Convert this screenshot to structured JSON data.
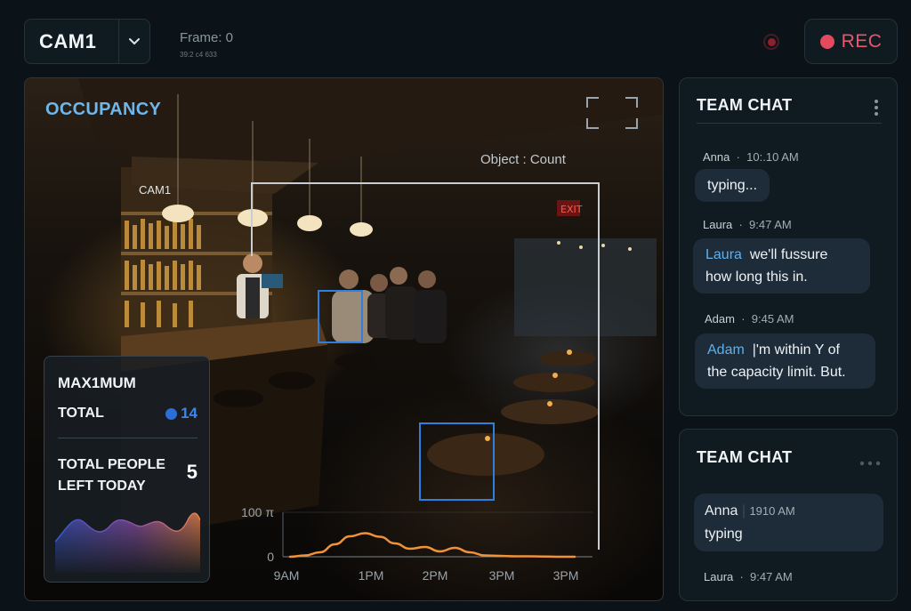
{
  "camera": {
    "selected": "CAM1",
    "frame": "Frame: 0",
    "frame_sub": "39:2 c4 633"
  },
  "record": {
    "label": "REC",
    "color": "#e6586a"
  },
  "feed": {
    "title": "OCCUPANCY",
    "cam_tag": "CAM1",
    "object_count_label": "Object : Count",
    "detection_color": "#2f7fe0"
  },
  "stats": {
    "max_label": "MAX1MUM",
    "total_label": "TOTAL",
    "total_value": "14",
    "left_label": "TOTAL PEOPLE LEFT TODAY",
    "left_value": "5"
  },
  "chart_data": {
    "type": "line",
    "x_ticks": [
      "9AM",
      "1PM",
      "2PM",
      "3PM",
      "3PM"
    ],
    "y_ticks": [
      "100 π",
      "0"
    ],
    "ylim": [
      0,
      100
    ],
    "series": [
      {
        "values": [
          0,
          3,
          10,
          28,
          46,
          53,
          45,
          30,
          18,
          22,
          12,
          20,
          10,
          3,
          2,
          1,
          1,
          0.5,
          0,
          0
        ]
      }
    ],
    "line_color": "#f0923a",
    "grid": false
  },
  "chat1": {
    "title": "TEAM CHAT",
    "messages": [
      {
        "name": "Anna",
        "time": "10:.10 AM",
        "who": "",
        "text": "typing..."
      },
      {
        "name": "Laura",
        "time": "9:47 AM",
        "who": "Laura",
        "text": "we'll fussure how long this in."
      },
      {
        "name": "Adam",
        "time": "9:45 AM",
        "who": "Adam",
        "text": "|'m within Y of the capacity limit. But."
      }
    ]
  },
  "chat2": {
    "title": "TEAM CHAT",
    "bubble_name": "Anna",
    "bubble_time": "1910 AM",
    "bubble_text": "typing",
    "next_name": "Laura",
    "next_time": "9:47 AM"
  }
}
